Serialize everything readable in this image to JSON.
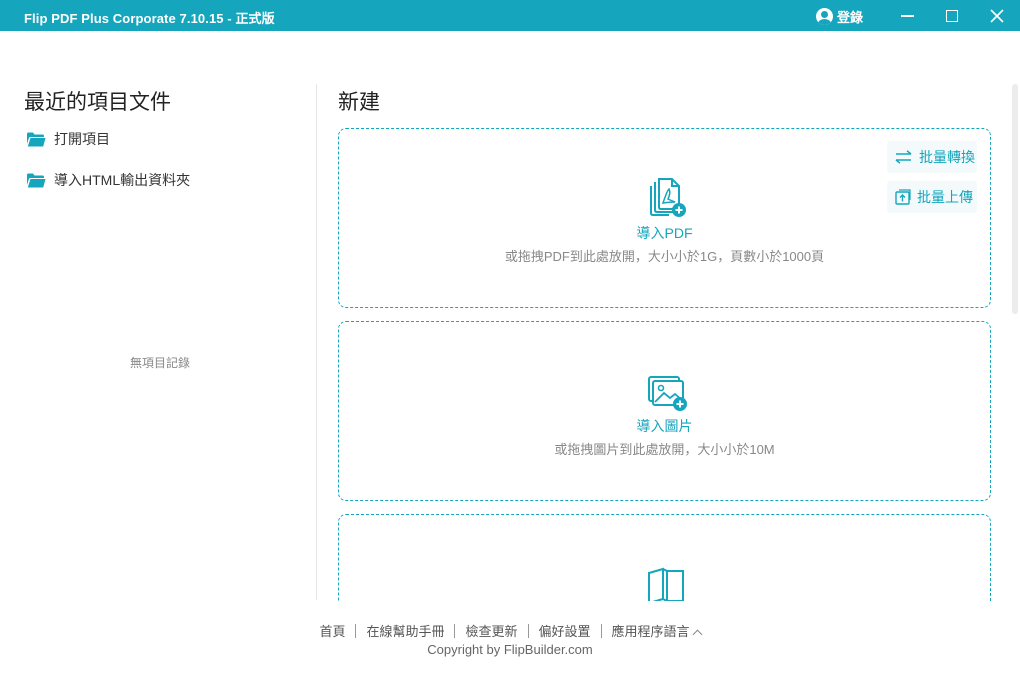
{
  "window": {
    "title": "Flip PDF Plus Corporate 7.10.15 - 正式版",
    "login_label": "登錄",
    "icons": {
      "login": "user-avatar-icon",
      "minimize": "minimize-icon",
      "maximize": "maximize-icon",
      "close": "close-icon"
    }
  },
  "recent": {
    "title": "最近的項目文件",
    "open_project": "打開項目",
    "import_html": "導入HTML輸出資料夾",
    "empty": "無項目記錄",
    "icons": {
      "folder": "folder-icon"
    }
  },
  "new_section": {
    "title": "新建",
    "batch_convert": "批量轉換",
    "batch_upload": "批量上傳",
    "cards": [
      {
        "label": "導入PDF",
        "hint": "或拖拽PDF到此處放開，大小小於1G，頁數小於1000頁",
        "icon": "import-pdf-icon"
      },
      {
        "label": "導入圖片",
        "hint": "或拖拽圖片到此處放開，大小小於10M",
        "icon": "import-image-icon"
      },
      {
        "label": "",
        "hint": "",
        "icon": "book-template-icon"
      }
    ]
  },
  "footer": {
    "links": [
      "首頁",
      "在線幫助手冊",
      "檢查更新",
      "偏好設置",
      "應用程序語言"
    ],
    "copyright": "Copyright by FlipBuilder.com"
  },
  "colors": {
    "accent": "#15a6bd",
    "titlebar": "#15a6bd"
  }
}
